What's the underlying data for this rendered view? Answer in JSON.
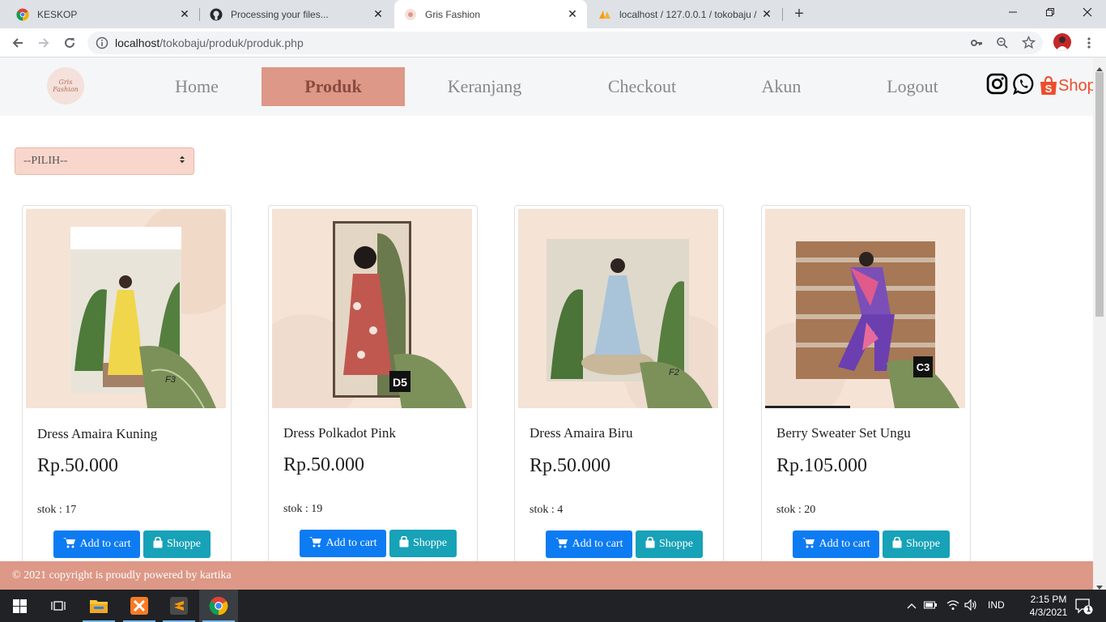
{
  "browser": {
    "tabs": [
      {
        "title": "KESKOP",
        "icon": "chrome-icon"
      },
      {
        "title": "Processing your files...",
        "icon": "github-icon"
      },
      {
        "title": "Gris Fashion",
        "icon": "gris-icon",
        "active": true
      },
      {
        "title": "localhost / 127.0.0.1 / tokobaju /",
        "icon": "phpmyadmin-icon"
      }
    ],
    "url_host": "localhost",
    "url_path": "/tokobaju/produk/produk.php"
  },
  "site": {
    "logo_text_1": "Gris",
    "logo_text_2": "Fashion",
    "nav": [
      "Home",
      "Produk",
      "Keranjang",
      "Checkout",
      "Akun",
      "Logout"
    ],
    "shopee_label": "Shopee",
    "select_value": "--PILIH--",
    "footer": "© 2021 copyright is proudly powered by kartika"
  },
  "products": [
    {
      "name": "Dress Amaira Kuning",
      "price": "Rp.50.000",
      "stock": "stok : 17",
      "cart_label": "Add to cart",
      "shop_label": "Shoppe",
      "tag": "F3",
      "dress_color": "#f0d64a"
    },
    {
      "name": "Dress Polkadot Pink",
      "price": "Rp.50.000",
      "stock": "stok : 19",
      "cart_label": "Add to cart",
      "shop_label": "Shoppe",
      "tag": "D5",
      "dress_color": "#c0584f"
    },
    {
      "name": "Dress Amaira Biru",
      "price": "Rp.50.000",
      "stock": "stok : 4",
      "cart_label": "Add to cart",
      "shop_label": "Shoppe",
      "tag": "F2",
      "dress_color": "#a9c4d8"
    },
    {
      "name": "Berry Sweater Set Ungu",
      "price": "Rp.105.000",
      "stock": "stok : 20",
      "cart_label": "Add to cart",
      "shop_label": "Shoppe",
      "tag": "C3",
      "dress_color": "#7b4fb8"
    }
  ],
  "taskbar": {
    "time": "2:15 PM",
    "date": "4/3/2021",
    "lang": "IND",
    "notif_count": "1"
  },
  "colors": {
    "accent": "#dd9887",
    "cart_button": "#0d7bf2",
    "shop_button": "#17a2b8",
    "select_bg": "#f9d6cc"
  }
}
